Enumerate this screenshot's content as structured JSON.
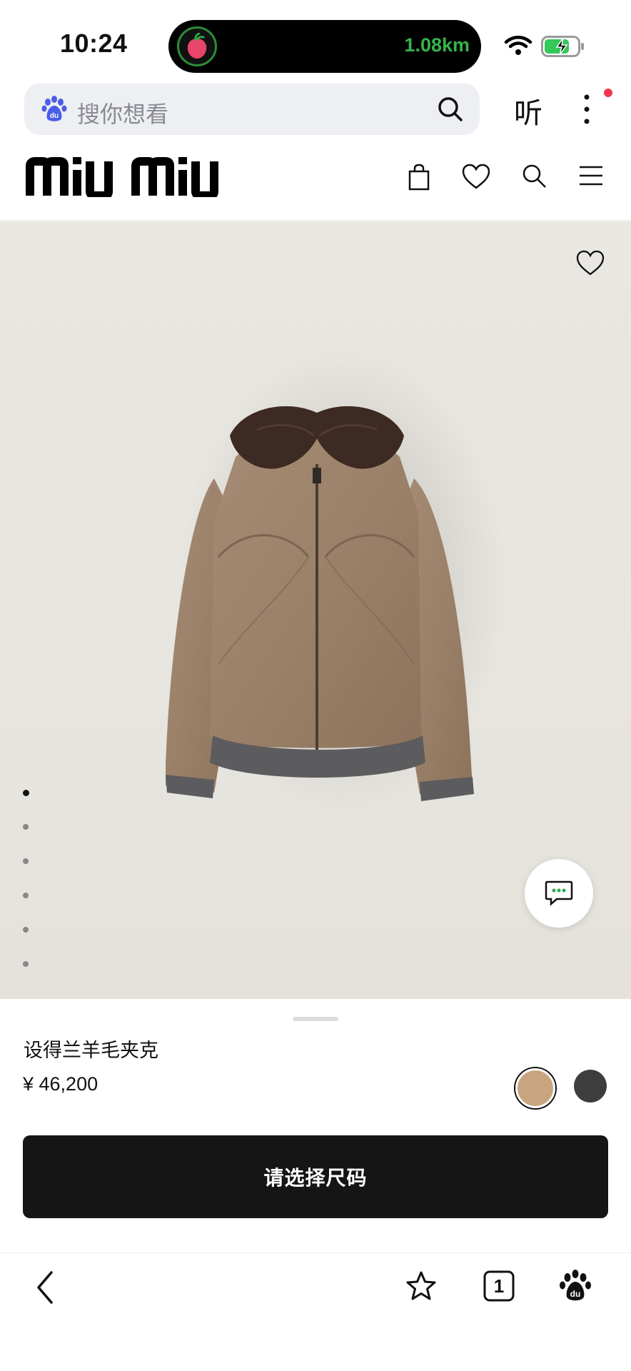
{
  "status_bar": {
    "time": "10:24",
    "activity_distance": "1.08km",
    "icons": [
      "wifi-icon",
      "battery-charging-icon"
    ]
  },
  "browser": {
    "search_placeholder": "搜你想看",
    "listen_label": "听",
    "icons": [
      "baidu-paw-icon",
      "search-icon",
      "more-vertical-icon"
    ]
  },
  "brand": {
    "logo_text": "miu miu",
    "header_icons": [
      "shopping-bag-icon",
      "heart-icon",
      "search-icon",
      "menu-icon"
    ]
  },
  "gallery": {
    "image_count": 6,
    "active_index": 0,
    "favorite_icon": "heart-outline-icon",
    "chat_icon": "chat-bubble-icon",
    "background_color": "#e8e6e0"
  },
  "product": {
    "name": "设得兰羊毛夹克",
    "price": "¥ 46,200",
    "colors": [
      {
        "hex": "#c9a57f",
        "selected": true
      },
      {
        "hex": "#3d3d3d",
        "selected": false
      }
    ],
    "cta_label": "请选择尺码"
  },
  "bottom_nav": {
    "tab_count": "1",
    "icons": [
      "back-arrow-icon",
      "star-icon",
      "tabs-icon",
      "baidu-paw-icon"
    ]
  }
}
